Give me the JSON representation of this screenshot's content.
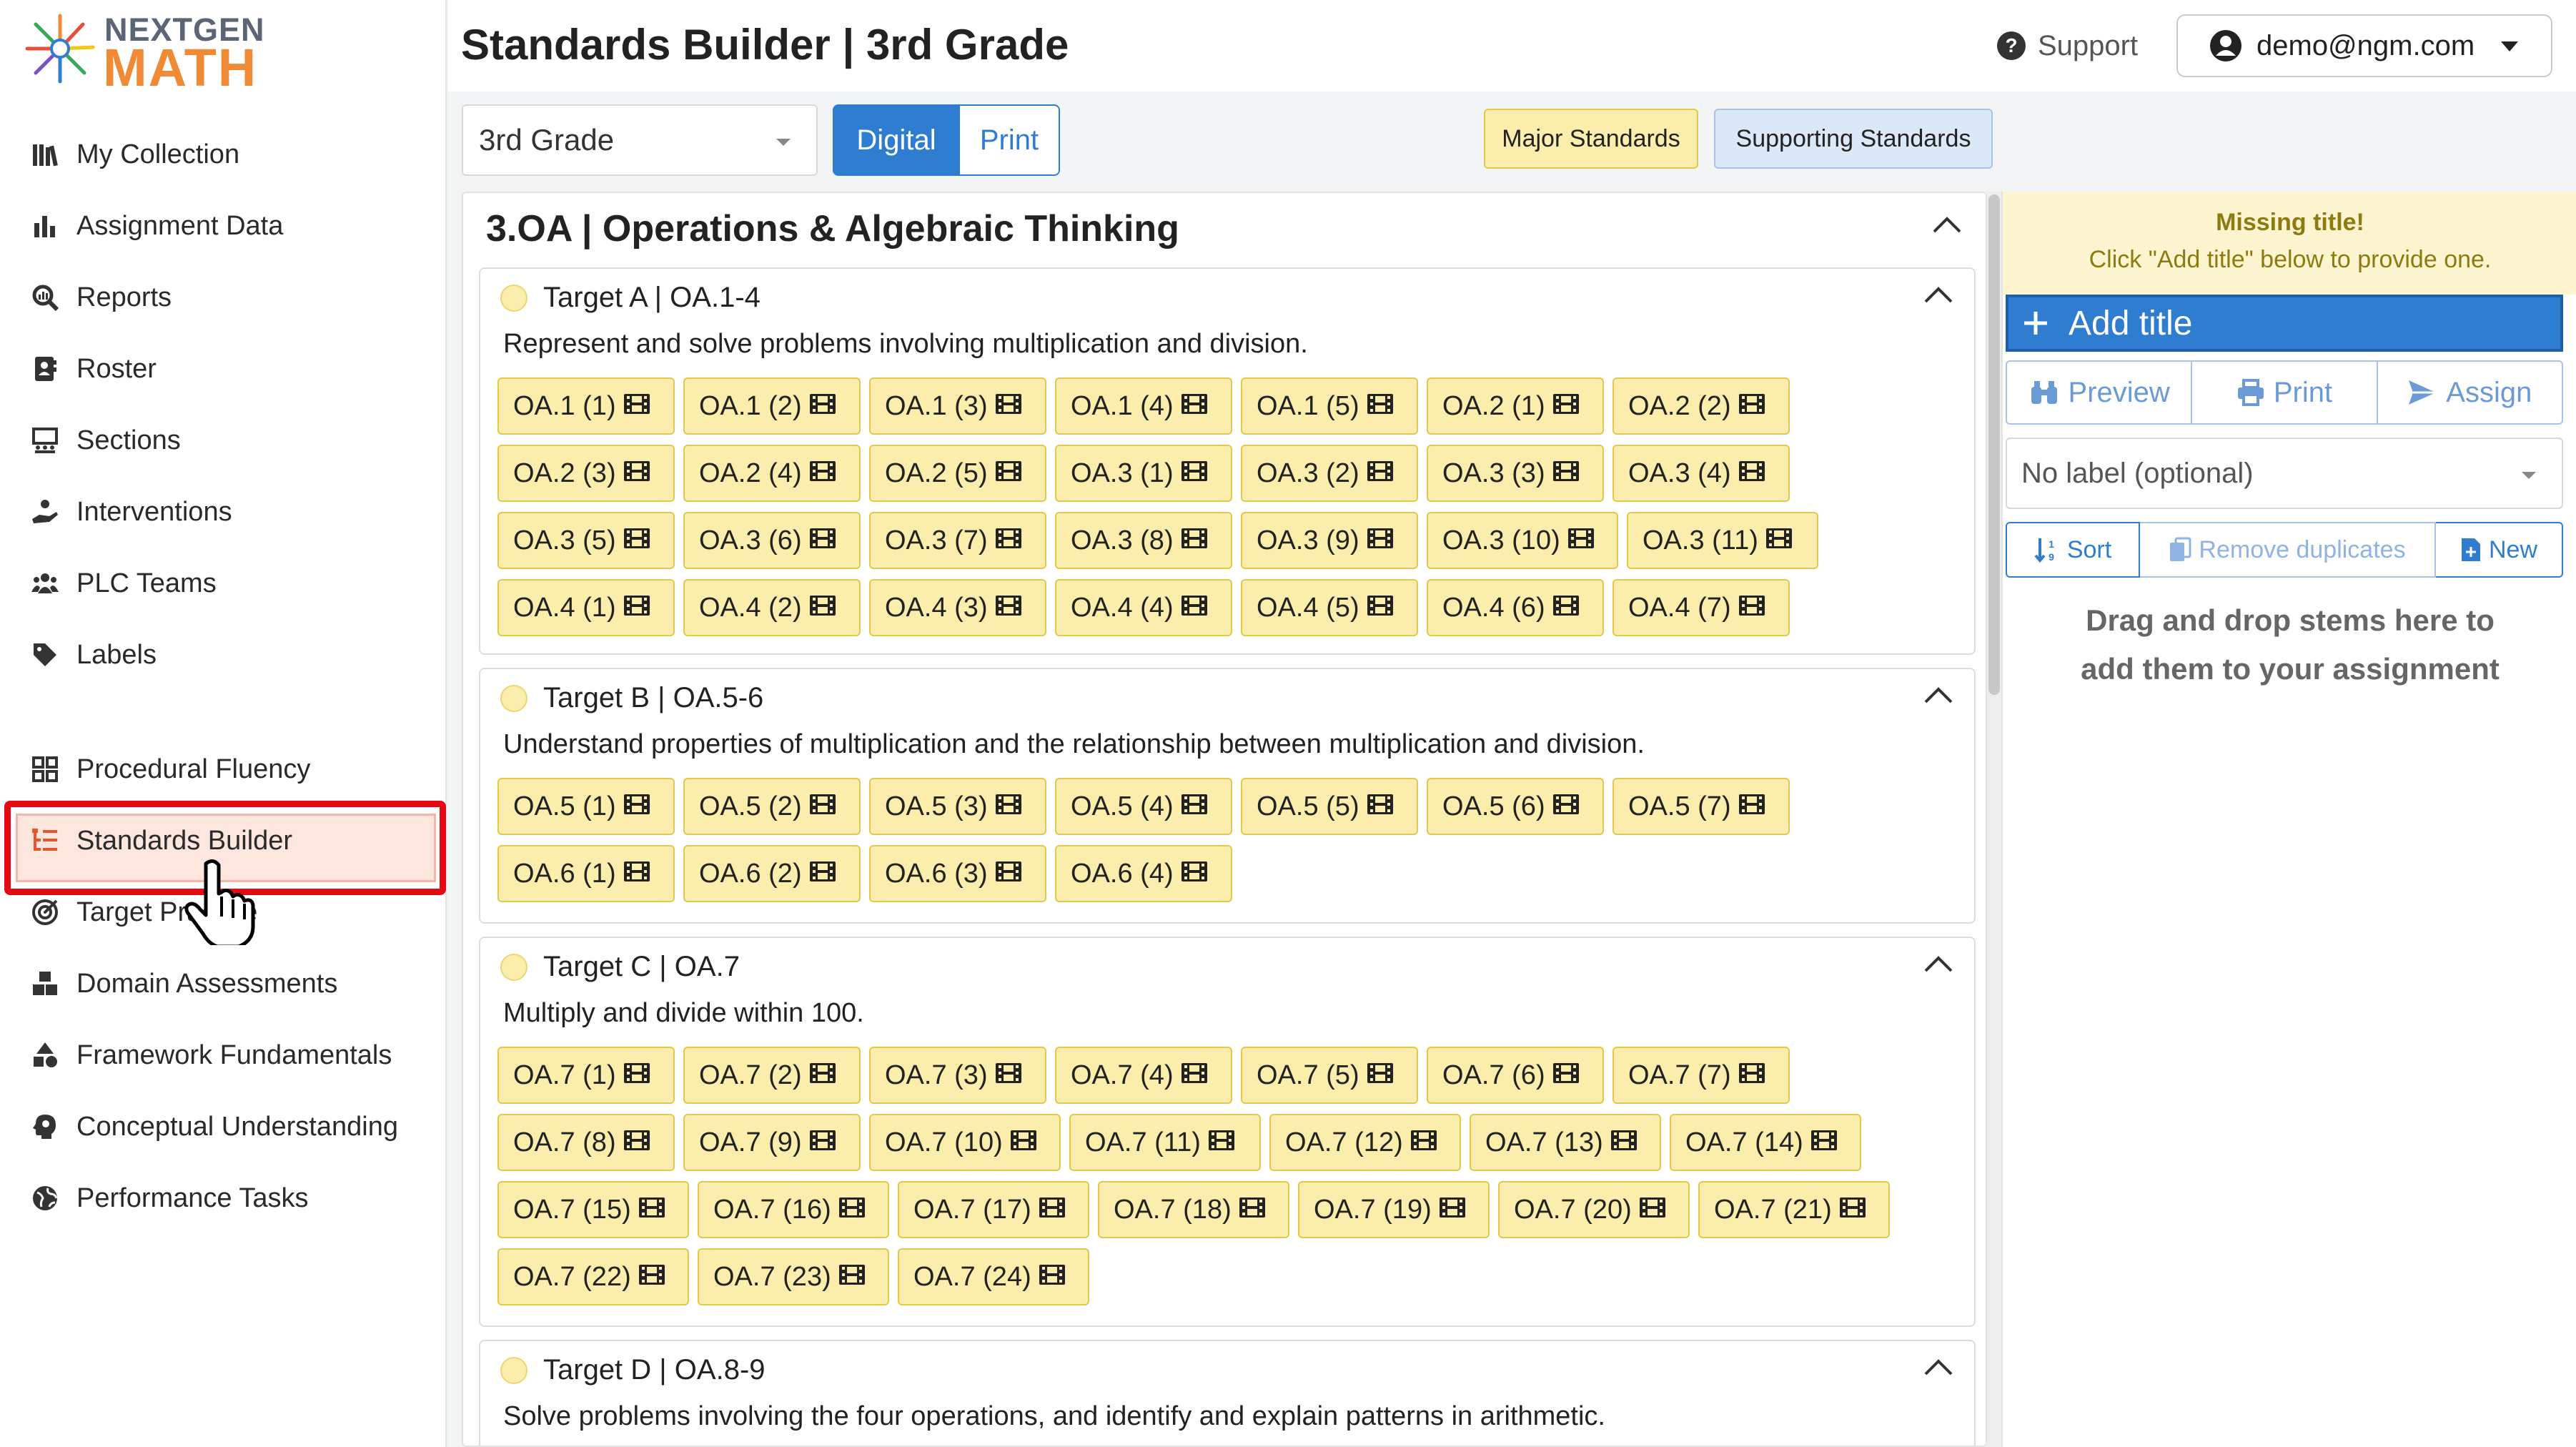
{
  "app": {
    "logo_top": "NEXTGEN",
    "logo_bottom": "MATH",
    "page_title": "Standards Builder | 3rd Grade"
  },
  "header": {
    "support_label": "Support",
    "account_email": "demo@ngm.com"
  },
  "sidebar": {
    "items": [
      {
        "label": "My Collection",
        "icon": "collection-icon"
      },
      {
        "label": "Assignment Data",
        "icon": "bar-chart-icon"
      },
      {
        "label": "Reports",
        "icon": "magnifier-report-icon"
      },
      {
        "label": "Roster",
        "icon": "address-book-icon"
      },
      {
        "label": "Sections",
        "icon": "sections-icon"
      },
      {
        "label": "Interventions",
        "icon": "hand-helping-icon"
      },
      {
        "label": "PLC Teams",
        "icon": "team-icon"
      },
      {
        "label": "Labels",
        "icon": "tag-icon"
      },
      {
        "label": "Procedural Fluency",
        "icon": "grid-icon"
      },
      {
        "label": "Standards Builder",
        "icon": "list-tree-icon",
        "active": true
      },
      {
        "label": "Target Practice",
        "icon": "target-icon"
      },
      {
        "label": "Domain Assessments",
        "icon": "cubes-icon"
      },
      {
        "label": "Framework Fundamentals",
        "icon": "shapes-icon"
      },
      {
        "label": "Conceptual Understanding",
        "icon": "head-brain-icon"
      },
      {
        "label": "Performance Tasks",
        "icon": "globe-icon"
      }
    ]
  },
  "toolbar": {
    "grade_value": "3rd Grade",
    "digital_label": "Digital",
    "print_label": "Print",
    "major_label": "Major Standards",
    "supporting_label": "Supporting Standards"
  },
  "domain": {
    "title": "3.OA | Operations & Algebraic Thinking",
    "targets": [
      {
        "title": "Target A | OA.1-4",
        "description": "Represent and solve problems involving multiplication and division.",
        "stems": [
          "OA.1 (1)",
          "OA.1 (2)",
          "OA.1 (3)",
          "OA.1 (4)",
          "OA.1 (5)",
          "OA.2 (1)",
          "OA.2 (2)",
          "OA.2 (3)",
          "OA.2 (4)",
          "OA.2 (5)",
          "OA.3 (1)",
          "OA.3 (2)",
          "OA.3 (3)",
          "OA.3 (4)",
          "OA.3 (5)",
          "OA.3 (6)",
          "OA.3 (7)",
          "OA.3 (8)",
          "OA.3 (9)",
          "OA.3 (10)",
          "OA.3 (11)",
          "OA.4 (1)",
          "OA.4 (2)",
          "OA.4 (3)",
          "OA.4 (4)",
          "OA.4 (5)",
          "OA.4 (6)",
          "OA.4 (7)"
        ]
      },
      {
        "title": "Target B | OA.5-6",
        "description": "Understand properties of multiplication and the relationship between multiplication and division.",
        "stems": [
          "OA.5 (1)",
          "OA.5 (2)",
          "OA.5 (3)",
          "OA.5 (4)",
          "OA.5 (5)",
          "OA.5 (6)",
          "OA.5 (7)",
          "OA.6 (1)",
          "OA.6 (2)",
          "OA.6 (3)",
          "OA.6 (4)"
        ]
      },
      {
        "title": "Target C | OA.7",
        "description": "Multiply and divide within 100.",
        "stems": [
          "OA.7 (1)",
          "OA.7 (2)",
          "OA.7 (3)",
          "OA.7 (4)",
          "OA.7 (5)",
          "OA.7 (6)",
          "OA.7 (7)",
          "OA.7 (8)",
          "OA.7 (9)",
          "OA.7 (10)",
          "OA.7 (11)",
          "OA.7 (12)",
          "OA.7 (13)",
          "OA.7 (14)",
          "OA.7 (15)",
          "OA.7 (16)",
          "OA.7 (17)",
          "OA.7 (18)",
          "OA.7 (19)",
          "OA.7 (20)",
          "OA.7 (21)",
          "OA.7 (22)",
          "OA.7 (23)",
          "OA.7 (24)"
        ]
      },
      {
        "title": "Target D | OA.8-9",
        "description": "Solve problems involving the four operations, and identify and explain patterns in arithmetic.",
        "stems": []
      }
    ]
  },
  "assignment": {
    "missing_title": "Missing title!",
    "missing_hint": "Click \"Add title\" below to provide one.",
    "add_title_label": "Add title",
    "preview_label": "Preview",
    "print_label": "Print",
    "assign_label": "Assign",
    "label_placeholder": "No label (optional)",
    "sort_label": "Sort",
    "remove_duplicates_label": "Remove duplicates",
    "new_label": "New",
    "drop_hint": "Drag and drop stems here to add them to your assignment"
  },
  "colors": {
    "brand_blue": "#2f7dd1",
    "major_yellow": "#fbeeac",
    "supporting_blue": "#dbe8f7",
    "highlight_red": "#e50914",
    "logo_orange": "#f08a34"
  }
}
